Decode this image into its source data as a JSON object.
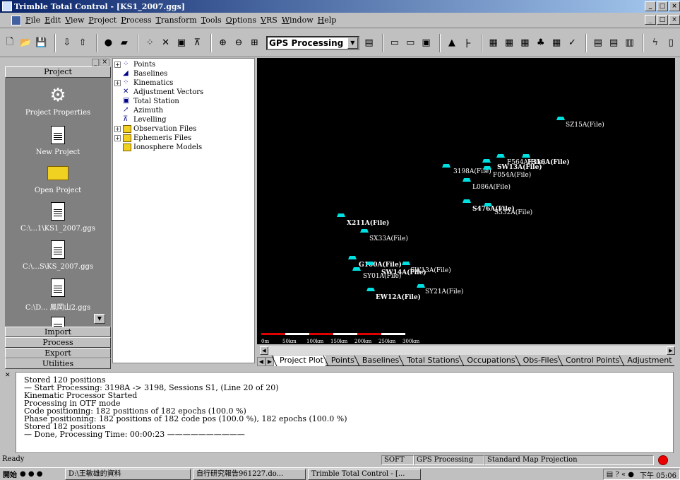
{
  "window": {
    "title": "Trimble Total Control - [KS1_2007.ggs]",
    "min": "_",
    "max": "□",
    "close": "×"
  },
  "menu": [
    "File",
    "Edit",
    "View",
    "Project",
    "Process",
    "Transform",
    "Tools",
    "Options",
    "VRS",
    "Window",
    "Help"
  ],
  "toolbar": {
    "mode_value": "GPS Processing",
    "combo_arrow": "▼"
  },
  "leftbar": {
    "header": "Project",
    "items": [
      {
        "label": "Project Properties",
        "icon": "gear-icon"
      },
      {
        "label": "New Project",
        "icon": "document-icon"
      },
      {
        "label": "Open Project",
        "icon": "folder-icon"
      },
      {
        "label": "C:\\...1\\KS1_2007.ggs",
        "icon": "document-icon"
      },
      {
        "label": "C:\\...S\\KS_2007.ggs",
        "icon": "document-icon"
      },
      {
        "label": "C:\\D...  鳳岡山2.ggs",
        "icon": "document-icon"
      }
    ],
    "buttons": [
      "Import",
      "Process",
      "Export",
      "Utilities"
    ]
  },
  "tree": {
    "items": [
      {
        "label": "Points",
        "icon": "points-icon",
        "expandable": true
      },
      {
        "label": "Baselines",
        "icon": "baselines-icon",
        "expandable": false
      },
      {
        "label": "Kinematics",
        "icon": "kinematics-icon",
        "expandable": true
      },
      {
        "label": "Adjustment Vectors",
        "icon": "vectors-icon",
        "expandable": false
      },
      {
        "label": "Total Station",
        "icon": "total-station-icon",
        "expandable": false
      },
      {
        "label": "Azimuth",
        "icon": "azimuth-icon",
        "expandable": false
      },
      {
        "label": "Levelling",
        "icon": "levelling-icon",
        "expandable": false
      },
      {
        "label": "Observation Files",
        "icon": "folder-icon",
        "expandable": true
      },
      {
        "label": "Ephemeris Files",
        "icon": "folder-icon",
        "expandable": true
      },
      {
        "label": "Ionosphere Models",
        "icon": "folder-icon",
        "expandable": false
      }
    ]
  },
  "map": {
    "accent": "#00e0e0",
    "points": [
      {
        "label": "SZ15A(File)",
        "bold": false
      },
      {
        "label": "F564A(File)",
        "bold": false
      },
      {
        "label": "F316A(File)",
        "bold": true
      },
      {
        "label": "SW13A(File)",
        "bold": true
      },
      {
        "label": "3198A(File)",
        "bold": false
      },
      {
        "label": "F054A(File)",
        "bold": false
      },
      {
        "label": "L086A(File)",
        "bold": false
      },
      {
        "label": "S476A(File)",
        "bold": true
      },
      {
        "label": "S532A(File)",
        "bold": false
      },
      {
        "label": "X211A(File)",
        "bold": true
      },
      {
        "label": "SX33A(File)",
        "bold": false
      },
      {
        "label": "G100A(File)",
        "bold": true
      },
      {
        "label": "SY01A(File)",
        "bold": false
      },
      {
        "label": "SW14A(File)",
        "bold": true
      },
      {
        "label": "SW13A(File)",
        "bold": false
      },
      {
        "label": "SY21A(File)",
        "bold": false
      },
      {
        "label": "EW12A(File)",
        "bold": true
      }
    ],
    "scale_labels": [
      "0m",
      "50km",
      "100km",
      "150km",
      "200km",
      "250km",
      "300km"
    ]
  },
  "tabs": [
    "Project Plot",
    "Points",
    "Baselines",
    "Total Stations",
    "Occupations",
    "Obs-Files",
    "Control Points",
    "Adjustment"
  ],
  "output": {
    "lines": [
      "Stored 120 positions",
      "— Start Processing: 3198A -> 3198, Sessions S1, (Line 20 of 20)",
      "Kinematic Processor Started",
      "Processing in OTF mode",
      "Code positioning: 182 positions of 182 epochs (100.0 %)",
      "Phase positioning: 182 positions of 182 code pos (100.0 %), 182 epochs (100.0 %)",
      "Stored 182 positions",
      "— Done, Processing Time: 00:00:23 ——————————"
    ]
  },
  "status": {
    "ready": "Ready",
    "soft": "SOFT",
    "mode": "GPS Processing",
    "projection": "Standard Map Projection"
  },
  "taskbar": {
    "start": "開始",
    "tasks": [
      "D:\\王敏雄的資料",
      "自行研究報告961227.do...",
      "Trimble Total Control - [..."
    ],
    "clock": "下午 05:06"
  }
}
